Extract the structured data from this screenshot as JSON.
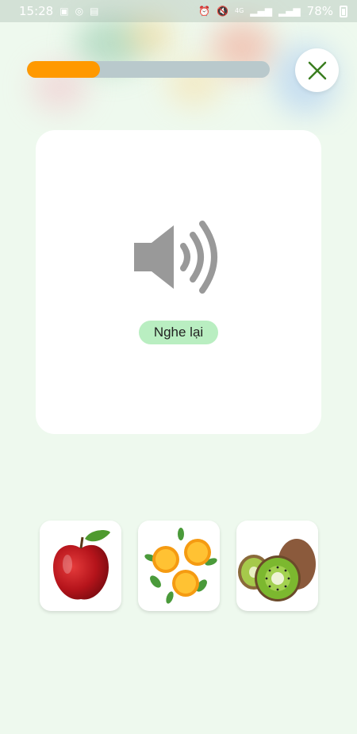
{
  "status_bar": {
    "time": "15:28",
    "battery_percent": "78%",
    "left_icons": [
      "image-icon",
      "instagram-icon",
      "news-icon"
    ],
    "right_icons": [
      "alarm-icon",
      "mute-icon",
      "signal-icon",
      "signal-icon",
      "battery-icon"
    ],
    "network_label": "4G"
  },
  "progress": {
    "fraction": 0.3,
    "fill_color": "#ff9900"
  },
  "close": {
    "icon": "close-icon",
    "color": "#3a7d1f"
  },
  "audio_card": {
    "speaker_icon": "speaker-icon",
    "replay_label": "Nghe lại"
  },
  "options": [
    {
      "icon": "apple-image"
    },
    {
      "icon": "orange-image"
    },
    {
      "icon": "kiwi-image"
    }
  ]
}
